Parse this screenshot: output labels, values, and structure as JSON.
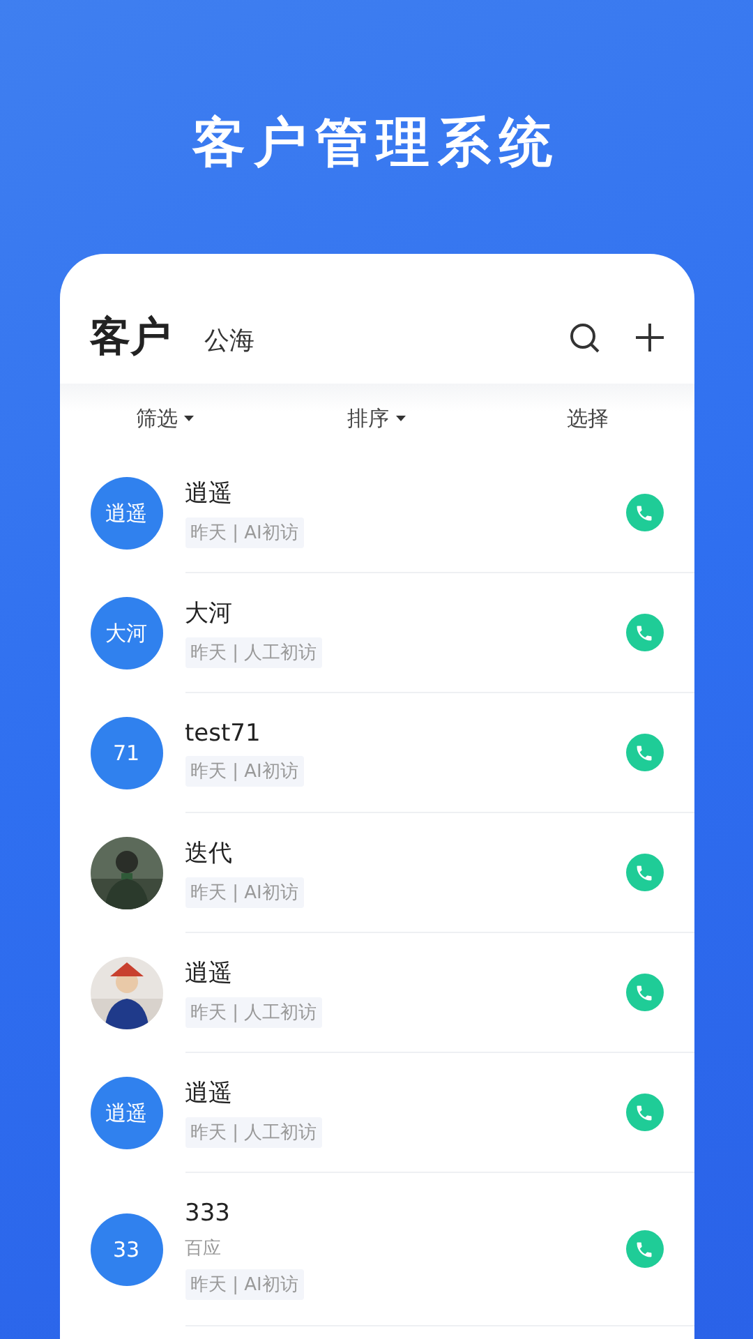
{
  "banner": {
    "title": "客户管理系统"
  },
  "header": {
    "title": "客户",
    "tab": "公海"
  },
  "toolbar": [
    {
      "label": "筛选",
      "dropdown": true
    },
    {
      "label": "排序",
      "dropdown": true
    },
    {
      "label": "选择",
      "dropdown": false
    }
  ],
  "customers": [
    {
      "avatar": {
        "kind": "initials",
        "text": "逍遥"
      },
      "name": "逍遥",
      "tag": "昨天 | AI初访"
    },
    {
      "avatar": {
        "kind": "initials",
        "text": "大河"
      },
      "name": "大河",
      "tag": "昨天 | 人工初访"
    },
    {
      "avatar": {
        "kind": "initials",
        "text": "71"
      },
      "name": "test71",
      "tag": "昨天 | AI初访"
    },
    {
      "name": "迭代",
      "tag": "昨天 | AI初访"
    },
    {
      "name": "逍遥",
      "tag": "昨天 | 人工初访"
    },
    {
      "avatar": {
        "kind": "initials",
        "text": "逍遥"
      },
      "name": "逍遥",
      "tag": "昨天 | 人工初访"
    },
    {
      "avatar": {
        "kind": "initials",
        "text": "33"
      },
      "name": "333",
      "company": "百应",
      "tag": "昨天 | AI初访"
    }
  ]
}
